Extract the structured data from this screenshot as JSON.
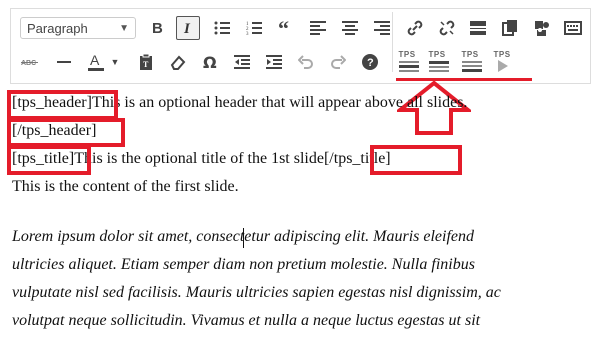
{
  "toolbar": {
    "format_select": "Paragraph",
    "tps_buttons": [
      {
        "label": "TPS",
        "kind": "header"
      },
      {
        "label": "TPS",
        "kind": "title"
      },
      {
        "label": "TPS",
        "kind": "footer"
      },
      {
        "label": "TPS",
        "kind": "play"
      }
    ]
  },
  "content": {
    "line1_tag": "[tps_header]",
    "line1_text": "This is an optional header that will appear above all slides.",
    "line2_tag": "[/tps_header]",
    "line3_open": "[tps_title]",
    "line3_text": "This is the optional title of the 1st slide",
    "line3_close": "[/tps_title]",
    "line4": "This is the content of the first slide.",
    "para_lines": [
      "Lorem ipsum dolor sit amet, consectetur adipiscing elit. Mauris eleifend",
      "ultricies aliquet. Etiam semper diam non pretium molestie. Nulla finibus",
      "vulputate nisl sed facilisis. Mauris ultricies sapien egestas nisl dignissim, ac",
      "volutpat neque sollicitudin. Vivamus et nulla a neque luctus egestas ut sit"
    ]
  },
  "colors": {
    "annotation": "#e41c2a",
    "icon": "#444444"
  }
}
